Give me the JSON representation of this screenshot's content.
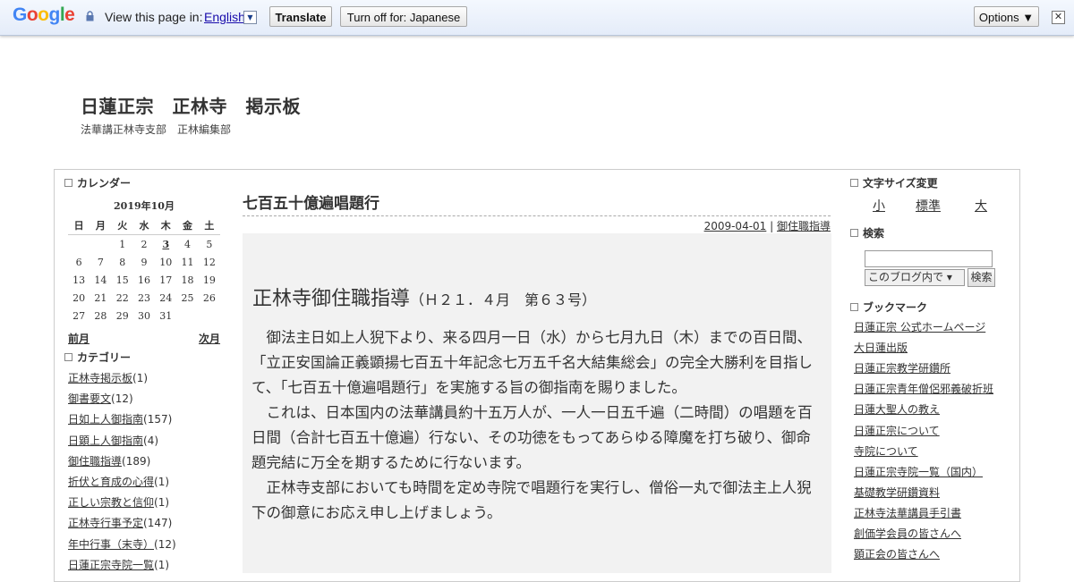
{
  "translate_bar": {
    "logo_letters": [
      "G",
      "o",
      "o",
      "g",
      "l",
      "e"
    ],
    "logo_colors": [
      "#4285f4",
      "#ea4335",
      "#fbbc05",
      "#4285f4",
      "#34a853",
      "#ea4335"
    ],
    "view_text": "View this page in:",
    "language": "English",
    "translate_label": "Translate",
    "turn_off_label": "Turn off for: Japanese",
    "options_label": "Options ▼",
    "close_label": "✕"
  },
  "header": {
    "title": "日蓮正宗　正林寺　掲示板",
    "description": "法華講正林寺支部　正林編集部"
  },
  "left": {
    "calendar_heading": "カレンダー",
    "calendar_month": "2019年10月",
    "weekdays": [
      "日",
      "月",
      "火",
      "水",
      "木",
      "金",
      "土"
    ],
    "weeks": [
      [
        "",
        "",
        "1",
        "2",
        "3",
        "4",
        "5"
      ],
      [
        "6",
        "7",
        "8",
        "9",
        "10",
        "11",
        "12"
      ],
      [
        "13",
        "14",
        "15",
        "16",
        "17",
        "18",
        "19"
      ],
      [
        "20",
        "21",
        "22",
        "23",
        "24",
        "25",
        "26"
      ],
      [
        "27",
        "28",
        "29",
        "30",
        "31",
        "",
        ""
      ]
    ],
    "prev_label": "前月",
    "next_label": "次月",
    "category_heading": "カテゴリー",
    "categories": [
      {
        "name": "正林寺掲示板",
        "count": "(1)"
      },
      {
        "name": "御書要文",
        "count": "(12)"
      },
      {
        "name": "日如上人御指南",
        "count": "(157)"
      },
      {
        "name": "日顕上人御指南",
        "count": "(4)"
      },
      {
        "name": "御住職指導",
        "count": "(189)"
      },
      {
        "name": "折伏と育成の心得",
        "count": "(1)"
      },
      {
        "name": "正しい宗教と信仰",
        "count": "(1)"
      },
      {
        "name": "正林寺行事予定",
        "count": "(147)"
      },
      {
        "name": "年中行事（末寺）",
        "count": "(12)"
      },
      {
        "name": "日蓮正宗寺院一覧",
        "count": "(1)"
      }
    ]
  },
  "post": {
    "title": "七百五十億遍唱題行",
    "date": "2009-04-01",
    "separator": " | ",
    "category": "御住職指導",
    "heading": "正林寺御住職指導",
    "heading_sub": "（Ｈ２１．４月　第６３号）",
    "paragraphs": [
      "御法主日如上人猊下より、来る四月一日（水）から七月九日（木）までの百日間、「立正安国論正義顕揚七百五十年記念七万五千名大結集総会」の完全大勝利を目指して、「七百五十億遍唱題行」を実施する旨の御指南を賜りました。",
      "これは、日本国内の法華講員約十五万人が、一人一日五千遍（二時間）の唱題を百日間（合計七百五十億遍）行ない、その功徳をもってあらゆる障魔を打ち破り、御命題完結に万全を期するために行ないます。",
      "正林寺支部においても時間を定め寺院で唱題行を実行し、僧俗一丸で御法主上人猊下の御意にお応え申し上げましょう。"
    ]
  },
  "right": {
    "font_size_heading": "文字サイズ変更",
    "font_small": "小",
    "font_normal": "標準",
    "font_large": "大",
    "search_heading": "検索",
    "search_scope": "このブログ内で ▾",
    "search_button": "検索",
    "bookmark_heading": "ブックマーク",
    "bookmarks": [
      "日蓮正宗 公式ホームページ",
      "大日蓮出版",
      "日蓮正宗教学研鑽所",
      "日蓮正宗青年僧侶邪義破折班",
      "日蓮大聖人の教え",
      "日蓮正宗について",
      "寺院について",
      "日蓮正宗寺院一覧（国内）",
      "基礎教学研鑽資料",
      "正林寺法華講員手引書",
      "創価学会員の皆さんへ",
      "顕正会の皆さんへ"
    ]
  }
}
